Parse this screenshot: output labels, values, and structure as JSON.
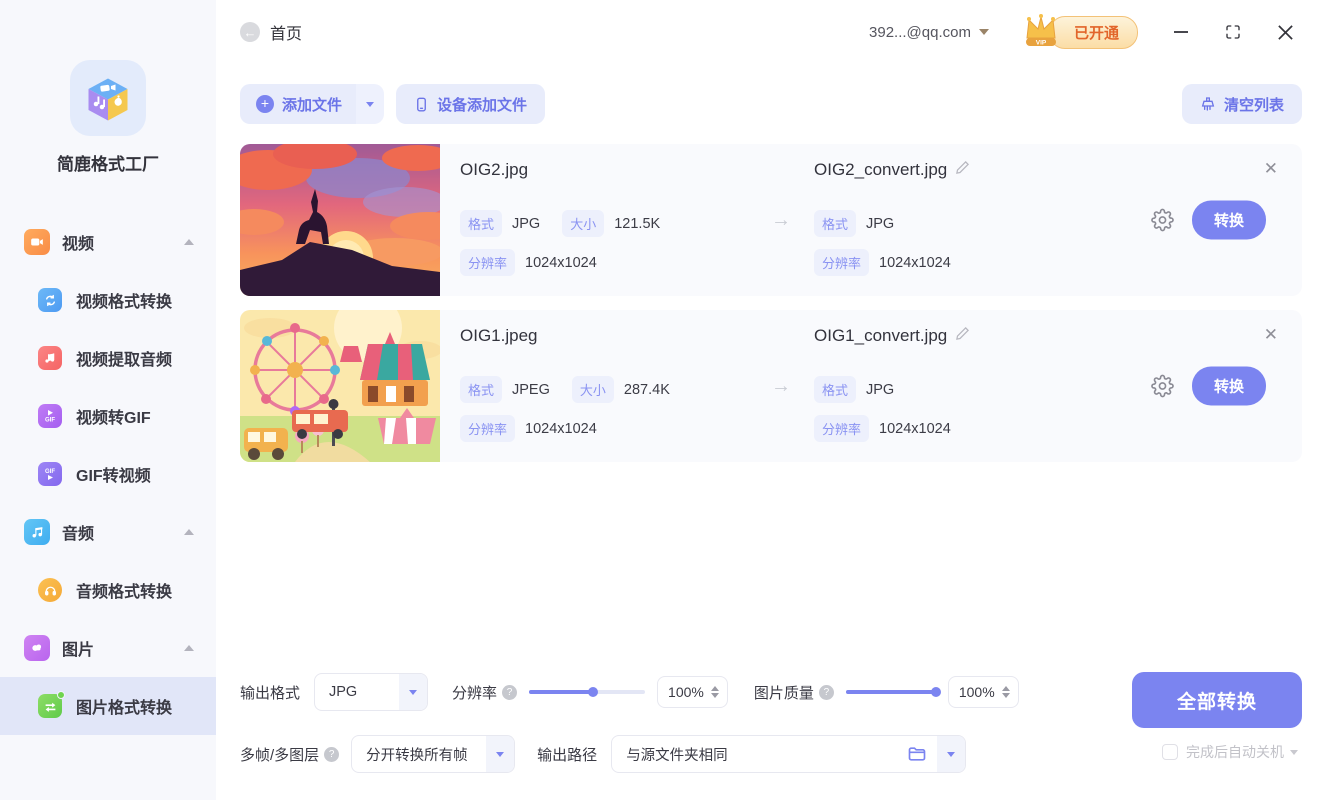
{
  "app": {
    "name": "简鹿格式工厂"
  },
  "topbar": {
    "home": "首页",
    "account": "392...@qq.com",
    "vip_status": "已开通",
    "vip_tag": "VIP"
  },
  "sidebar": {
    "items": [
      {
        "label": "视频"
      },
      {
        "label": "视频格式转换"
      },
      {
        "label": "视频提取音频"
      },
      {
        "label": "视频转GIF"
      },
      {
        "label": "GIF转视频"
      },
      {
        "label": "音频"
      },
      {
        "label": "音频格式转换"
      },
      {
        "label": "图片"
      },
      {
        "label": "图片格式转换"
      }
    ]
  },
  "toolbar": {
    "add_file": "添加文件",
    "add_from_device": "设备添加文件",
    "clear_list": "清空列表"
  },
  "labels": {
    "format": "格式",
    "size": "大小",
    "resolution": "分辨率",
    "convert": "转换",
    "arrow": "→",
    "close": "✕"
  },
  "files": [
    {
      "name": "OIG2.jpg",
      "format": "JPG",
      "size": "121.5K",
      "resolution": "1024x1024",
      "output_name": "OIG2_convert.jpg",
      "output_format": "JPG",
      "output_resolution": "1024x1024"
    },
    {
      "name": "OIG1.jpeg",
      "format": "JPEG",
      "size": "287.4K",
      "resolution": "1024x1024",
      "output_name": "OIG1_convert.jpg",
      "output_format": "JPG",
      "output_resolution": "1024x1024"
    }
  ],
  "settings": {
    "output_format_label": "输出格式",
    "output_format_value": "JPG",
    "resolution_label": "分辨率",
    "resolution_percent": "100%",
    "quality_label": "图片质量",
    "quality_percent": "100%",
    "multiframe_label": "多帧/多图层",
    "multiframe_value": "分开转换所有帧",
    "output_path_label": "输出路径",
    "output_path_value": "与源文件夹相同",
    "convert_all": "全部转换",
    "auto_shutdown": "完成后自动关机",
    "help": "?"
  },
  "colors": {
    "primary": "#7B84F0",
    "primary_light_bg": "#E8ECFB",
    "sidebar_bg": "#F7F8FC",
    "sidebar_active_bg": "#E1E6F8",
    "tag_bg": "#EDF0FC",
    "tag_text": "#8A93F2",
    "vip_text": "#E2652A",
    "card_bg": "#F9FAFD"
  }
}
